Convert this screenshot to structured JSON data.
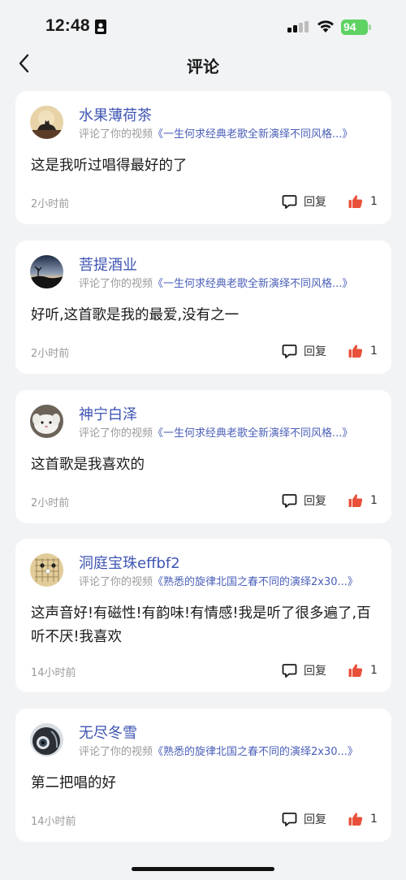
{
  "status_bar": {
    "time": "12:48",
    "battery": "94"
  },
  "nav": {
    "title": "评论"
  },
  "actions": {
    "reply_label": "回复"
  },
  "comments": [
    {
      "username": "水果薄荷茶",
      "action_text": "评论了你的视频",
      "video_title": "《一生何求经典老歌全新演绎不同风格...》",
      "content": "这是我听过唱得最好的了",
      "time": "2小时前",
      "likes": "1",
      "avatar_icon": "cat-avatar"
    },
    {
      "username": "菩提酒业",
      "action_text": "评论了你的视频",
      "video_title": "《一生何求经典老歌全新演绎不同风格...》",
      "content": "好听,这首歌是我的最爱,没有之一",
      "time": "2小时前",
      "likes": "1",
      "avatar_icon": "sunset-avatar"
    },
    {
      "username": "神宁白泽",
      "action_text": "评论了你的视频",
      "video_title": "《一生何求经典老歌全新演绎不同风格...》",
      "content": "这首歌是我喜欢的",
      "time": "2小时前",
      "likes": "1",
      "avatar_icon": "white-creature-avatar"
    },
    {
      "username": "洞庭宝珠effbf2",
      "action_text": "评论了你的视频",
      "video_title": "《熟悉的旋律北国之春不同的演绎2x30...》",
      "content": "这声音好!有磁性!有韵味!有情感!我是听了很多遍了,百听不厌!我喜欢",
      "time": "14小时前",
      "likes": "1",
      "avatar_icon": "go-board-avatar"
    },
    {
      "username": "无尽冬雪",
      "action_text": "评论了你的视频",
      "video_title": "《熟悉的旋律北国之春不同的演绎2x30...》",
      "content": "第二把唱的好",
      "time": "14小时前",
      "likes": "1",
      "avatar_icon": "portrait-avatar"
    }
  ],
  "colors": {
    "username": "#3f55b3",
    "like": "#e8503a",
    "battery": "#5ed262"
  }
}
